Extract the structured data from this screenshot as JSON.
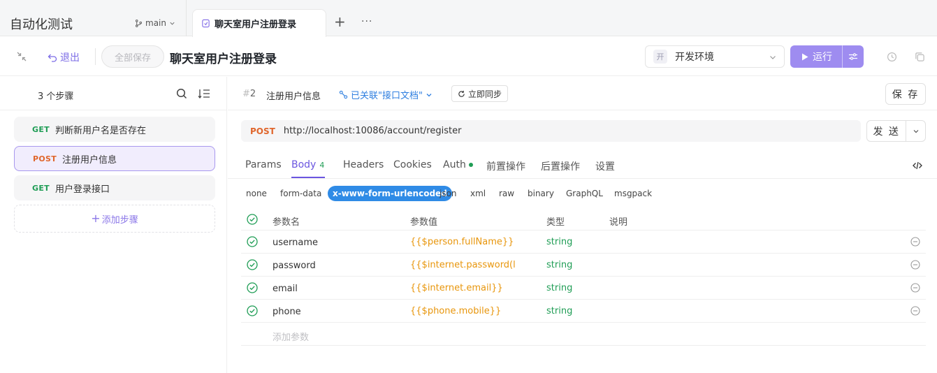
{
  "window": {
    "project_title": "自动化测试",
    "branch": "main",
    "active_tab": "聊天室用户注册登录",
    "new_tab": "+",
    "more": "···"
  },
  "toolbar": {
    "exit_label": "退出",
    "save_all_label": "全部保存",
    "page_title": "聊天室用户注册登录",
    "env_badge": "开",
    "env_label": "开发环境",
    "run_label": "运行"
  },
  "steps": {
    "count_label": "3 个步骤",
    "items": [
      {
        "method": "GET",
        "name": "判断新用户名是否存在"
      },
      {
        "method": "POST",
        "name": "注册用户信息",
        "active": true
      },
      {
        "method": "GET",
        "name": "用户登录接口"
      }
    ],
    "add_label": "添加步骤"
  },
  "request": {
    "hash": "#",
    "step_number": "2",
    "step_name": "注册用户信息",
    "linked_label": "已关联\"接口文档\"",
    "sync_label": "立即同步",
    "save_label": "保 存",
    "method": "POST",
    "url": "http://localhost:10086/account/register",
    "send_label": "发 送",
    "tabs": [
      "Params",
      "Body",
      "Headers",
      "Cookies",
      "Auth",
      "前置操作",
      "后置操作",
      "设置"
    ],
    "body_count": "4",
    "body_types": [
      "none",
      "form-data",
      "x-www-form-urlencoded",
      "json",
      "xml",
      "raw",
      "binary",
      "GraphQL",
      "msgpack"
    ],
    "active_body_type": "x-www-form-urlencoded"
  },
  "params": {
    "headers": [
      "参数名",
      "参数值",
      "类型",
      "说明"
    ],
    "rows": [
      {
        "name": "username",
        "value": "{{$person.fullName}}",
        "type": "string",
        "desc": ""
      },
      {
        "name": "password",
        "value": "{{$internet.password(l...",
        "type": "string",
        "desc": ""
      },
      {
        "name": "email",
        "value": "{{$internet.email}}",
        "type": "string",
        "desc": ""
      },
      {
        "name": "phone",
        "value": "{{$phone.mobile}}",
        "type": "string",
        "desc": ""
      }
    ],
    "add_placeholder": "添加参数"
  },
  "colors": {
    "accent": "#6b56e0",
    "run_button": "#9e8cf0",
    "get": "#1f9d55",
    "post": "#e0662c",
    "variable": "#e8960c",
    "link": "#2f7fe0",
    "body_type_active": "#2f8be6"
  },
  "icons": {
    "branch": "git-branch-icon",
    "tab": "scenario-icon",
    "collapse": "collapse-icon",
    "exit": "undo-arrow-icon",
    "env_chevron": "chevron-down-icon",
    "run": "play-icon",
    "run_settings": "sliders-icon",
    "history": "history-icon",
    "copy": "copy-icon",
    "search": "search-icon",
    "sort": "sort-list-icon",
    "linked": "link-icon",
    "sync": "refresh-icon",
    "send_chevron": "chevron-down-icon",
    "code": "code-icon",
    "check": "checkbox-checked-icon",
    "remove": "remove-circle-icon"
  }
}
